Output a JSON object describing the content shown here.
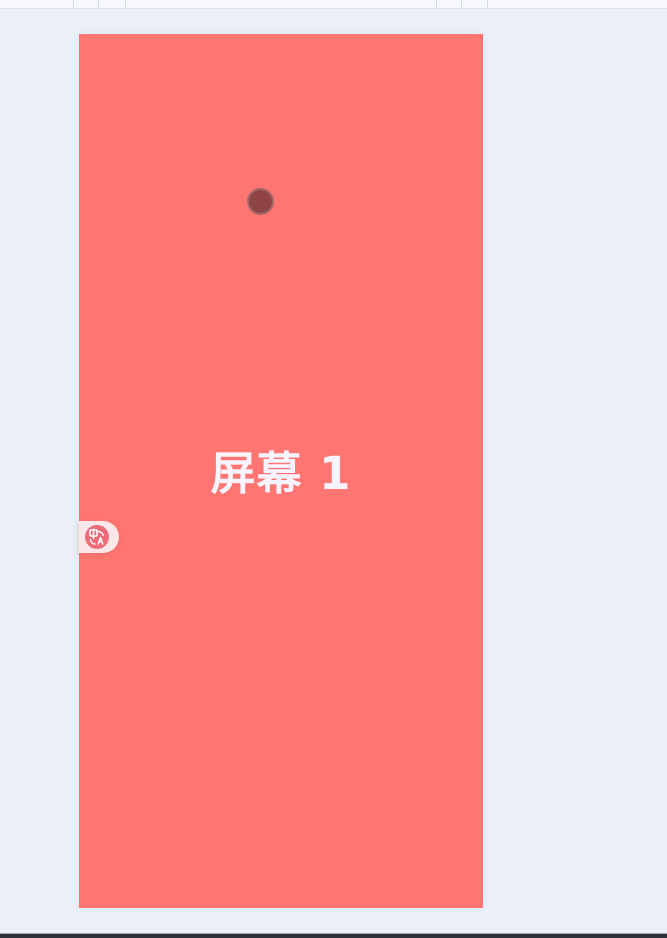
{
  "screen": {
    "title": "屏幕 1",
    "background_color": "#ff7571"
  },
  "floating_tool": {
    "icon": "translate-icon"
  }
}
